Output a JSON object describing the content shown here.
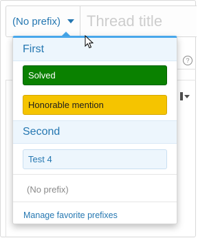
{
  "header": {
    "prefix_label": "(No prefix)",
    "title_placeholder": "Thread title"
  },
  "prefix_menu": {
    "groups": [
      {
        "name": "First",
        "prefixes": [
          {
            "label": "Solved",
            "color": "#0a8100"
          },
          {
            "label": "Honorable mention",
            "color": "#f5c400"
          }
        ]
      },
      {
        "name": "Second",
        "prefixes": [
          {
            "label": "Test 4",
            "color": "#edf6fd"
          }
        ]
      }
    ],
    "no_prefix_label": "(No prefix)",
    "manage_link": "Manage favorite prefixes"
  },
  "background": {
    "help_icon_glyph": "?"
  },
  "colors": {
    "accent": "#2577b1",
    "menu_top_border": "#47a7eb"
  }
}
